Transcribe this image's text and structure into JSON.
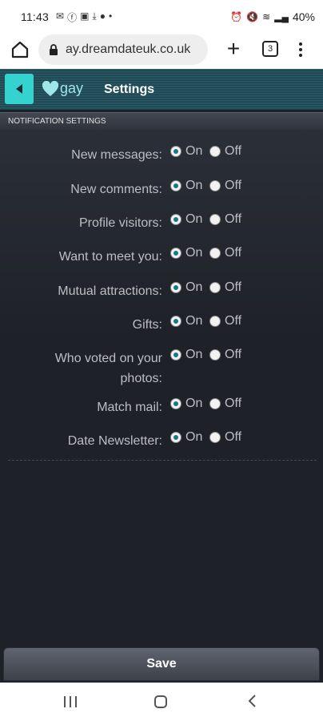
{
  "status_bar": {
    "time": "11:43",
    "left_icons": [
      "mail-icon",
      "facebook-icon",
      "calendar-icon",
      "download-icon",
      "vpn-icon",
      "dot-icon"
    ],
    "right_icons": [
      "alarm-icon",
      "mute-icon",
      "wifi-icon",
      "signal-icon"
    ],
    "battery": "40%"
  },
  "browser": {
    "url": "ay.dreamdateuk.co.uk",
    "tab_count": "3"
  },
  "header": {
    "logo_text": "gay",
    "title": "Settings"
  },
  "section": {
    "title": "NOTIFICATION SETTINGS"
  },
  "options": {
    "on": "On",
    "off": "Off"
  },
  "settings": [
    {
      "label": "New messages:",
      "selected": "on"
    },
    {
      "label": "New comments:",
      "selected": "on"
    },
    {
      "label": "Profile visitors:",
      "selected": "on"
    },
    {
      "label": "Want to meet you:",
      "selected": "on"
    },
    {
      "label": "Mutual attractions:",
      "selected": "on"
    },
    {
      "label": "Gifts:",
      "selected": "on"
    },
    {
      "label": "Who voted on your photos:",
      "selected": "on"
    },
    {
      "label": "Match mail:",
      "selected": "on"
    },
    {
      "label": "Date Newsletter:",
      "selected": "on"
    }
  ],
  "save": {
    "label": "Save"
  },
  "colors": {
    "accent": "#35d3d0",
    "radio_checked": "#147a82",
    "background": "#1e2128"
  }
}
